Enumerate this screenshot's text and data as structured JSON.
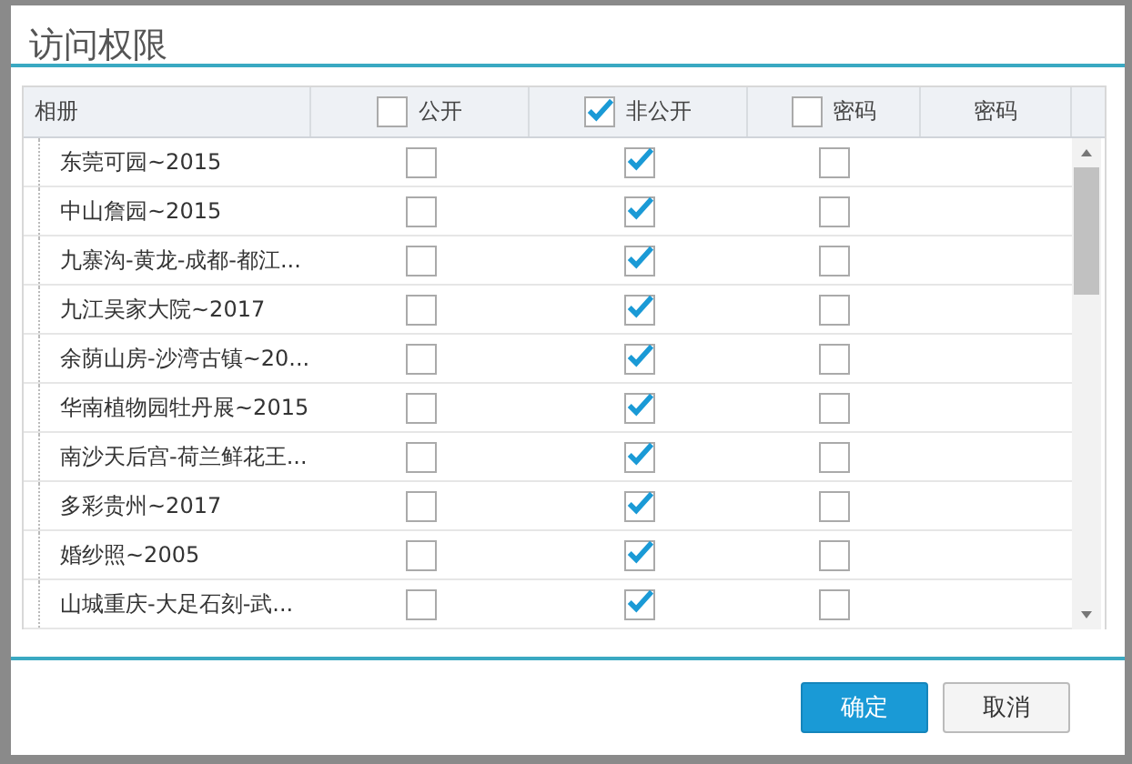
{
  "window": {
    "title": "访问权限"
  },
  "table": {
    "columns": [
      {
        "label": "相册",
        "kind": "text"
      },
      {
        "label": "公开",
        "kind": "check",
        "checked": false
      },
      {
        "label": "非公开",
        "kind": "check",
        "checked": true
      },
      {
        "label": "密码",
        "kind": "check",
        "checked": false
      },
      {
        "label": "密码",
        "kind": "text"
      }
    ],
    "rows": [
      {
        "name": "东莞可园~2015",
        "public": false,
        "private": true,
        "password": false
      },
      {
        "name": "中山詹园~2015",
        "public": false,
        "private": true,
        "password": false
      },
      {
        "name": "九寨沟-黄龙-成都-都江...",
        "public": false,
        "private": true,
        "password": false
      },
      {
        "name": "九江吴家大院~2017",
        "public": false,
        "private": true,
        "password": false
      },
      {
        "name": "余荫山房-沙湾古镇~20...",
        "public": false,
        "private": true,
        "password": false
      },
      {
        "name": "华南植物园牡丹展~2015",
        "public": false,
        "private": true,
        "password": false
      },
      {
        "name": "南沙天后宫-荷兰鲜花王...",
        "public": false,
        "private": true,
        "password": false
      },
      {
        "name": "多彩贵州~2017",
        "public": false,
        "private": true,
        "password": false
      },
      {
        "name": "婚纱照~2005",
        "public": false,
        "private": true,
        "password": false
      },
      {
        "name": "山城重庆-大足石刻-武...",
        "public": false,
        "private": true,
        "password": false
      }
    ]
  },
  "buttons": [
    {
      "label": "确定",
      "kind": "primary"
    },
    {
      "label": "取消",
      "kind": "secondary"
    }
  ]
}
